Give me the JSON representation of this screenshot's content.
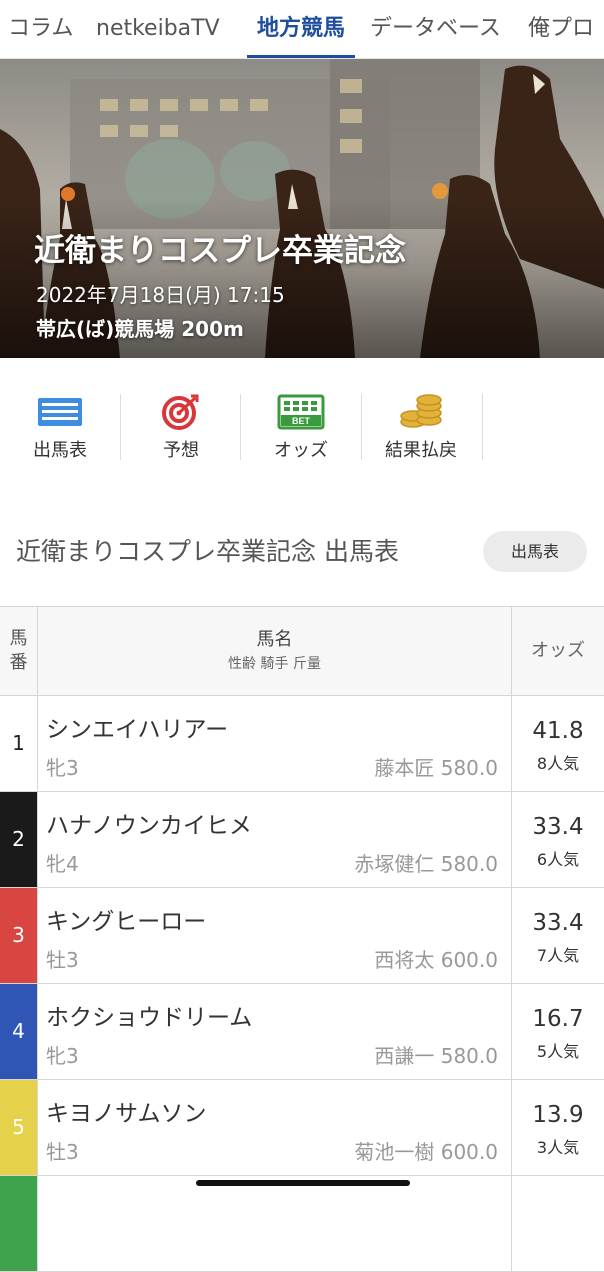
{
  "nav": {
    "tabs": [
      {
        "label": "コラム",
        "active": false
      },
      {
        "label": "netkeibaTV",
        "active": false
      },
      {
        "label": "地方競馬",
        "active": true
      },
      {
        "label": "データベース",
        "active": false
      },
      {
        "label": "俺プロ",
        "active": false
      }
    ]
  },
  "hero": {
    "title": "近衛まりコスプレ卒業記念",
    "datetime": "2022年7月18日(月) 17:15",
    "venue": "帯広(ば)競馬場 200m"
  },
  "menu": [
    {
      "label": "出馬表",
      "icon": "entry-table-icon"
    },
    {
      "label": "予想",
      "icon": "target-icon"
    },
    {
      "label": "オッズ",
      "icon": "bet-icon"
    },
    {
      "label": "結果払戻",
      "icon": "coins-icon"
    }
  ],
  "section": {
    "title": "近衛まりコスプレ卒業記念 出馬表",
    "button": "出馬表"
  },
  "table": {
    "header": {
      "num_top": "馬",
      "num_bottom": "番",
      "name": "馬名",
      "sub": "性齢 騎手 斤量",
      "odds": "オッズ"
    },
    "rows": [
      {
        "num": "1",
        "name": "シンエイハリアー",
        "sex_age": "牝3",
        "jockey_weight": "藤本匠 580.0",
        "odds": "41.8",
        "pop": "8人気",
        "color": "#ffffff",
        "text": "#222222"
      },
      {
        "num": "2",
        "name": "ハナノウンカイヒメ",
        "sex_age": "牝4",
        "jockey_weight": "赤塚健仁 580.0",
        "odds": "33.4",
        "pop": "6人気",
        "color": "#1a1a1a",
        "text": "#ffffff"
      },
      {
        "num": "3",
        "name": "キングヒーロー",
        "sex_age": "牡3",
        "jockey_weight": "西将太 600.0",
        "odds": "33.4",
        "pop": "7人気",
        "color": "#d94541",
        "text": "#ffffff"
      },
      {
        "num": "4",
        "name": "ホクショウドリーム",
        "sex_age": "牝3",
        "jockey_weight": "西謙一 580.0",
        "odds": "16.7",
        "pop": "5人気",
        "color": "#2f56b5",
        "text": "#ffffff"
      },
      {
        "num": "5",
        "name": "キヨノサムソン",
        "sex_age": "牡3",
        "jockey_weight": "菊池一樹 600.0",
        "odds": "13.9",
        "pop": "3人気",
        "color": "#e5d24a",
        "text": "#ffffff"
      },
      {
        "num": "",
        "name": "",
        "sex_age": "",
        "jockey_weight": "",
        "odds": "",
        "pop": "",
        "color": "#3fa34d",
        "text": "#ffffff"
      }
    ]
  }
}
